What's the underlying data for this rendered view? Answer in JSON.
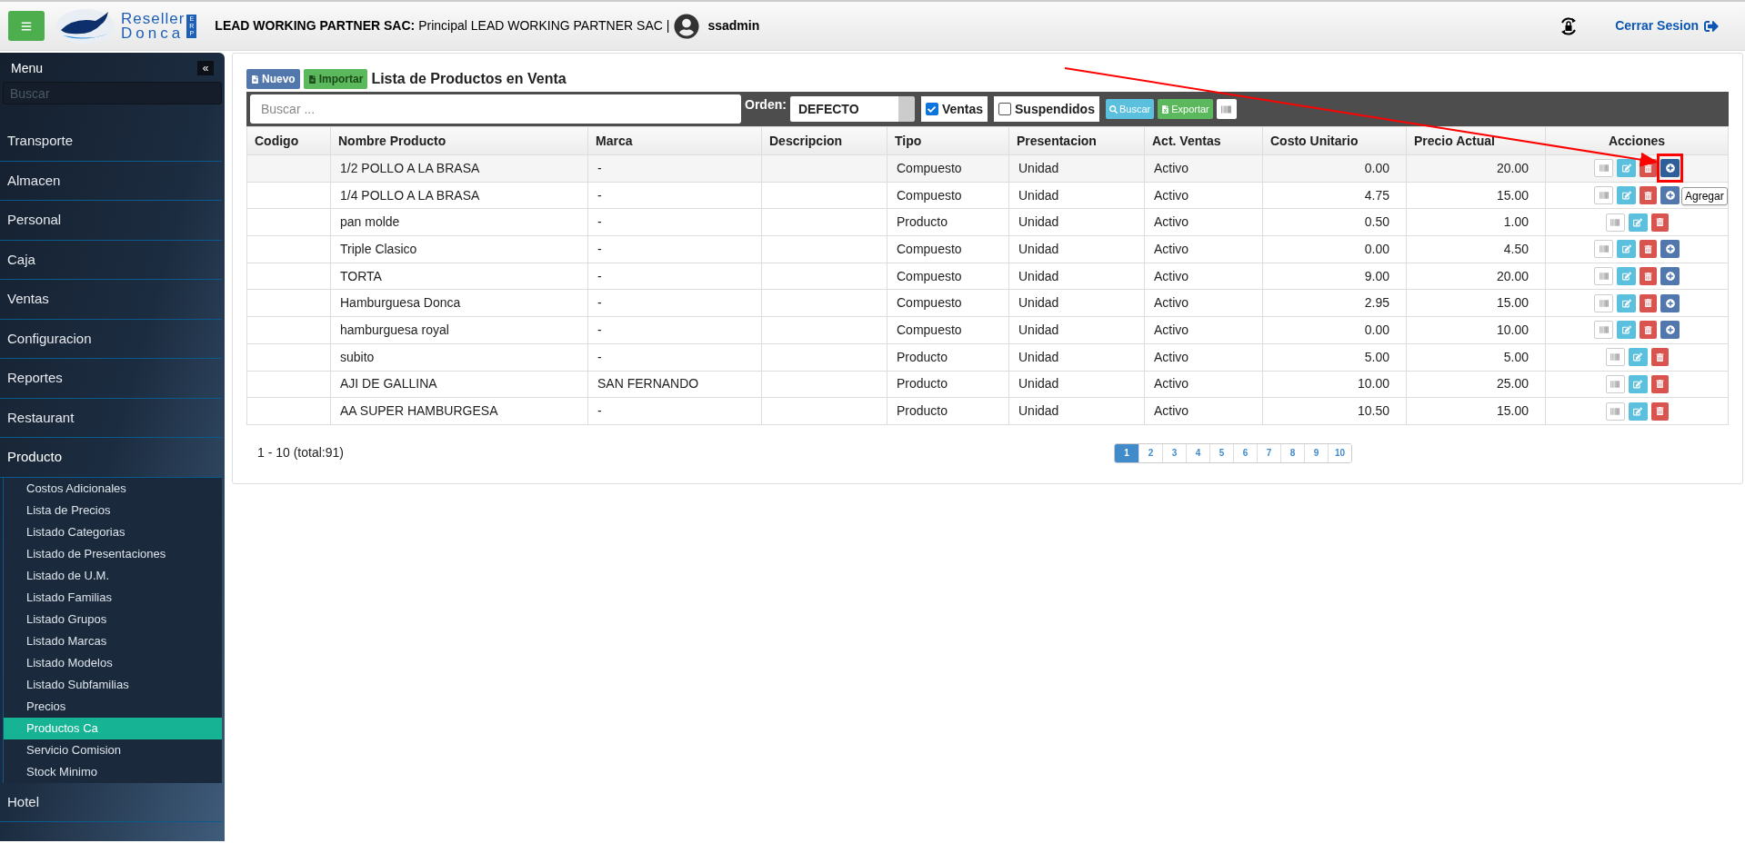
{
  "header": {
    "logo_top": "Reseller",
    "logo_bottom": "Donca",
    "logo_badge": "ERP",
    "company_label": "LEAD WORKING PARTNER SAC:",
    "company_detail": "Principal LEAD WORKING PARTNER SAC |",
    "user": "ssadmin",
    "logout": "Cerrar Sesion"
  },
  "sidebar": {
    "title": "Menu",
    "collapse": "«",
    "search_placeholder": "Buscar",
    "items": [
      {
        "label": "Transporte",
        "expanded": false
      },
      {
        "label": "Almacen",
        "expanded": false
      },
      {
        "label": "Personal",
        "expanded": false
      },
      {
        "label": "Caja",
        "expanded": false
      },
      {
        "label": "Ventas",
        "expanded": false
      },
      {
        "label": "Configuracion",
        "expanded": false
      },
      {
        "label": "Reportes",
        "expanded": false
      },
      {
        "label": "Restaurant",
        "expanded": false
      },
      {
        "label": "Producto",
        "expanded": true,
        "children": [
          {
            "label": "Costos Adicionales",
            "selected": false
          },
          {
            "label": "Lista de Precios",
            "selected": false
          },
          {
            "label": "Listado Categorias",
            "selected": false
          },
          {
            "label": "Listado de Presentaciones",
            "selected": false
          },
          {
            "label": "Listado de U.M.",
            "selected": false
          },
          {
            "label": "Listado Familias",
            "selected": false
          },
          {
            "label": "Listado Grupos",
            "selected": false
          },
          {
            "label": "Listado Marcas",
            "selected": false
          },
          {
            "label": "Listado Modelos",
            "selected": false
          },
          {
            "label": "Listado Subfamilias",
            "selected": false
          },
          {
            "label": "Precios",
            "selected": false
          },
          {
            "label": "Productos Ca",
            "selected": true
          },
          {
            "label": "Servicio Comision",
            "selected": false
          },
          {
            "label": "Stock Minimo",
            "selected": false
          }
        ]
      },
      {
        "label": "Hotel",
        "expanded": false
      }
    ]
  },
  "panel": {
    "new_button": "Nuevo",
    "import_button": "Importar",
    "title": "Lista de Productos en Venta",
    "toolbar": {
      "search_placeholder": "Buscar ...",
      "order_label": "Orden:",
      "order_value": "DEFECTO",
      "ventas": {
        "label": "Ventas",
        "checked": true
      },
      "suspendidos": {
        "label": "Suspendidos",
        "checked": false
      },
      "search_button": "Buscar",
      "export_button": "Exportar"
    },
    "table": {
      "columns": [
        "Codigo",
        "Nombre Producto",
        "Marca",
        "Descripcion",
        "Tipo",
        "Presentacion",
        "Act. Ventas",
        "Costo Unitario",
        "Precio Actual",
        "Acciones"
      ],
      "rows": [
        {
          "cells": [
            "",
            "1/2 POLLO A LA BRASA",
            "-",
            "",
            "Compuesto",
            "Unidad",
            "Activo",
            "0.00",
            "20.00"
          ],
          "has_add": true,
          "add_highlighted": true
        },
        {
          "cells": [
            "",
            "1/4 POLLO A LA BRASA",
            "-",
            "",
            "Compuesto",
            "Unidad",
            "Activo",
            "4.75",
            "15.00"
          ],
          "has_add": true,
          "add_highlighted": false,
          "tooltip": "Agregar"
        },
        {
          "cells": [
            "",
            "pan molde",
            "-",
            "",
            "Producto",
            "Unidad",
            "Activo",
            "0.50",
            "1.00"
          ],
          "has_add": false
        },
        {
          "cells": [
            "",
            "Triple Clasico",
            "-",
            "",
            "Compuesto",
            "Unidad",
            "Activo",
            "0.00",
            "4.50"
          ],
          "has_add": true,
          "add_highlighted": false
        },
        {
          "cells": [
            "",
            "TORTA",
            "-",
            "",
            "Compuesto",
            "Unidad",
            "Activo",
            "9.00",
            "20.00"
          ],
          "has_add": true,
          "add_highlighted": false
        },
        {
          "cells": [
            "",
            "Hamburguesa Donca",
            "-",
            "",
            "Compuesto",
            "Unidad",
            "Activo",
            "2.95",
            "15.00"
          ],
          "has_add": true,
          "add_highlighted": false
        },
        {
          "cells": [
            "",
            "hamburguesa royal",
            "-",
            "",
            "Compuesto",
            "Unidad",
            "Activo",
            "0.00",
            "10.00"
          ],
          "has_add": true,
          "add_highlighted": false
        },
        {
          "cells": [
            "",
            "subito",
            "-",
            "",
            "Producto",
            "Unidad",
            "Activo",
            "5.00",
            "5.00"
          ],
          "has_add": false
        },
        {
          "cells": [
            "",
            "AJI DE GALLINA",
            "SAN FERNANDO",
            "",
            "Producto",
            "Unidad",
            "Activo",
            "10.00",
            "25.00"
          ],
          "has_add": false
        },
        {
          "cells": [
            "",
            "AA SUPER HAMBURGESA",
            "-",
            "",
            "Producto",
            "Unidad",
            "Activo",
            "10.50",
            "15.00"
          ],
          "has_add": false
        }
      ]
    },
    "summary": "1 - 10 (total:91)",
    "pages": [
      {
        "label": "1",
        "selected": true
      },
      {
        "label": "2",
        "selected": false
      },
      {
        "label": "3",
        "selected": false
      },
      {
        "label": "4",
        "selected": false
      },
      {
        "label": "5",
        "selected": false
      },
      {
        "label": "6",
        "selected": false
      },
      {
        "label": "7",
        "selected": false
      },
      {
        "label": "8",
        "selected": false
      },
      {
        "label": "9",
        "selected": false
      },
      {
        "label": "10",
        "selected": false
      }
    ]
  }
}
